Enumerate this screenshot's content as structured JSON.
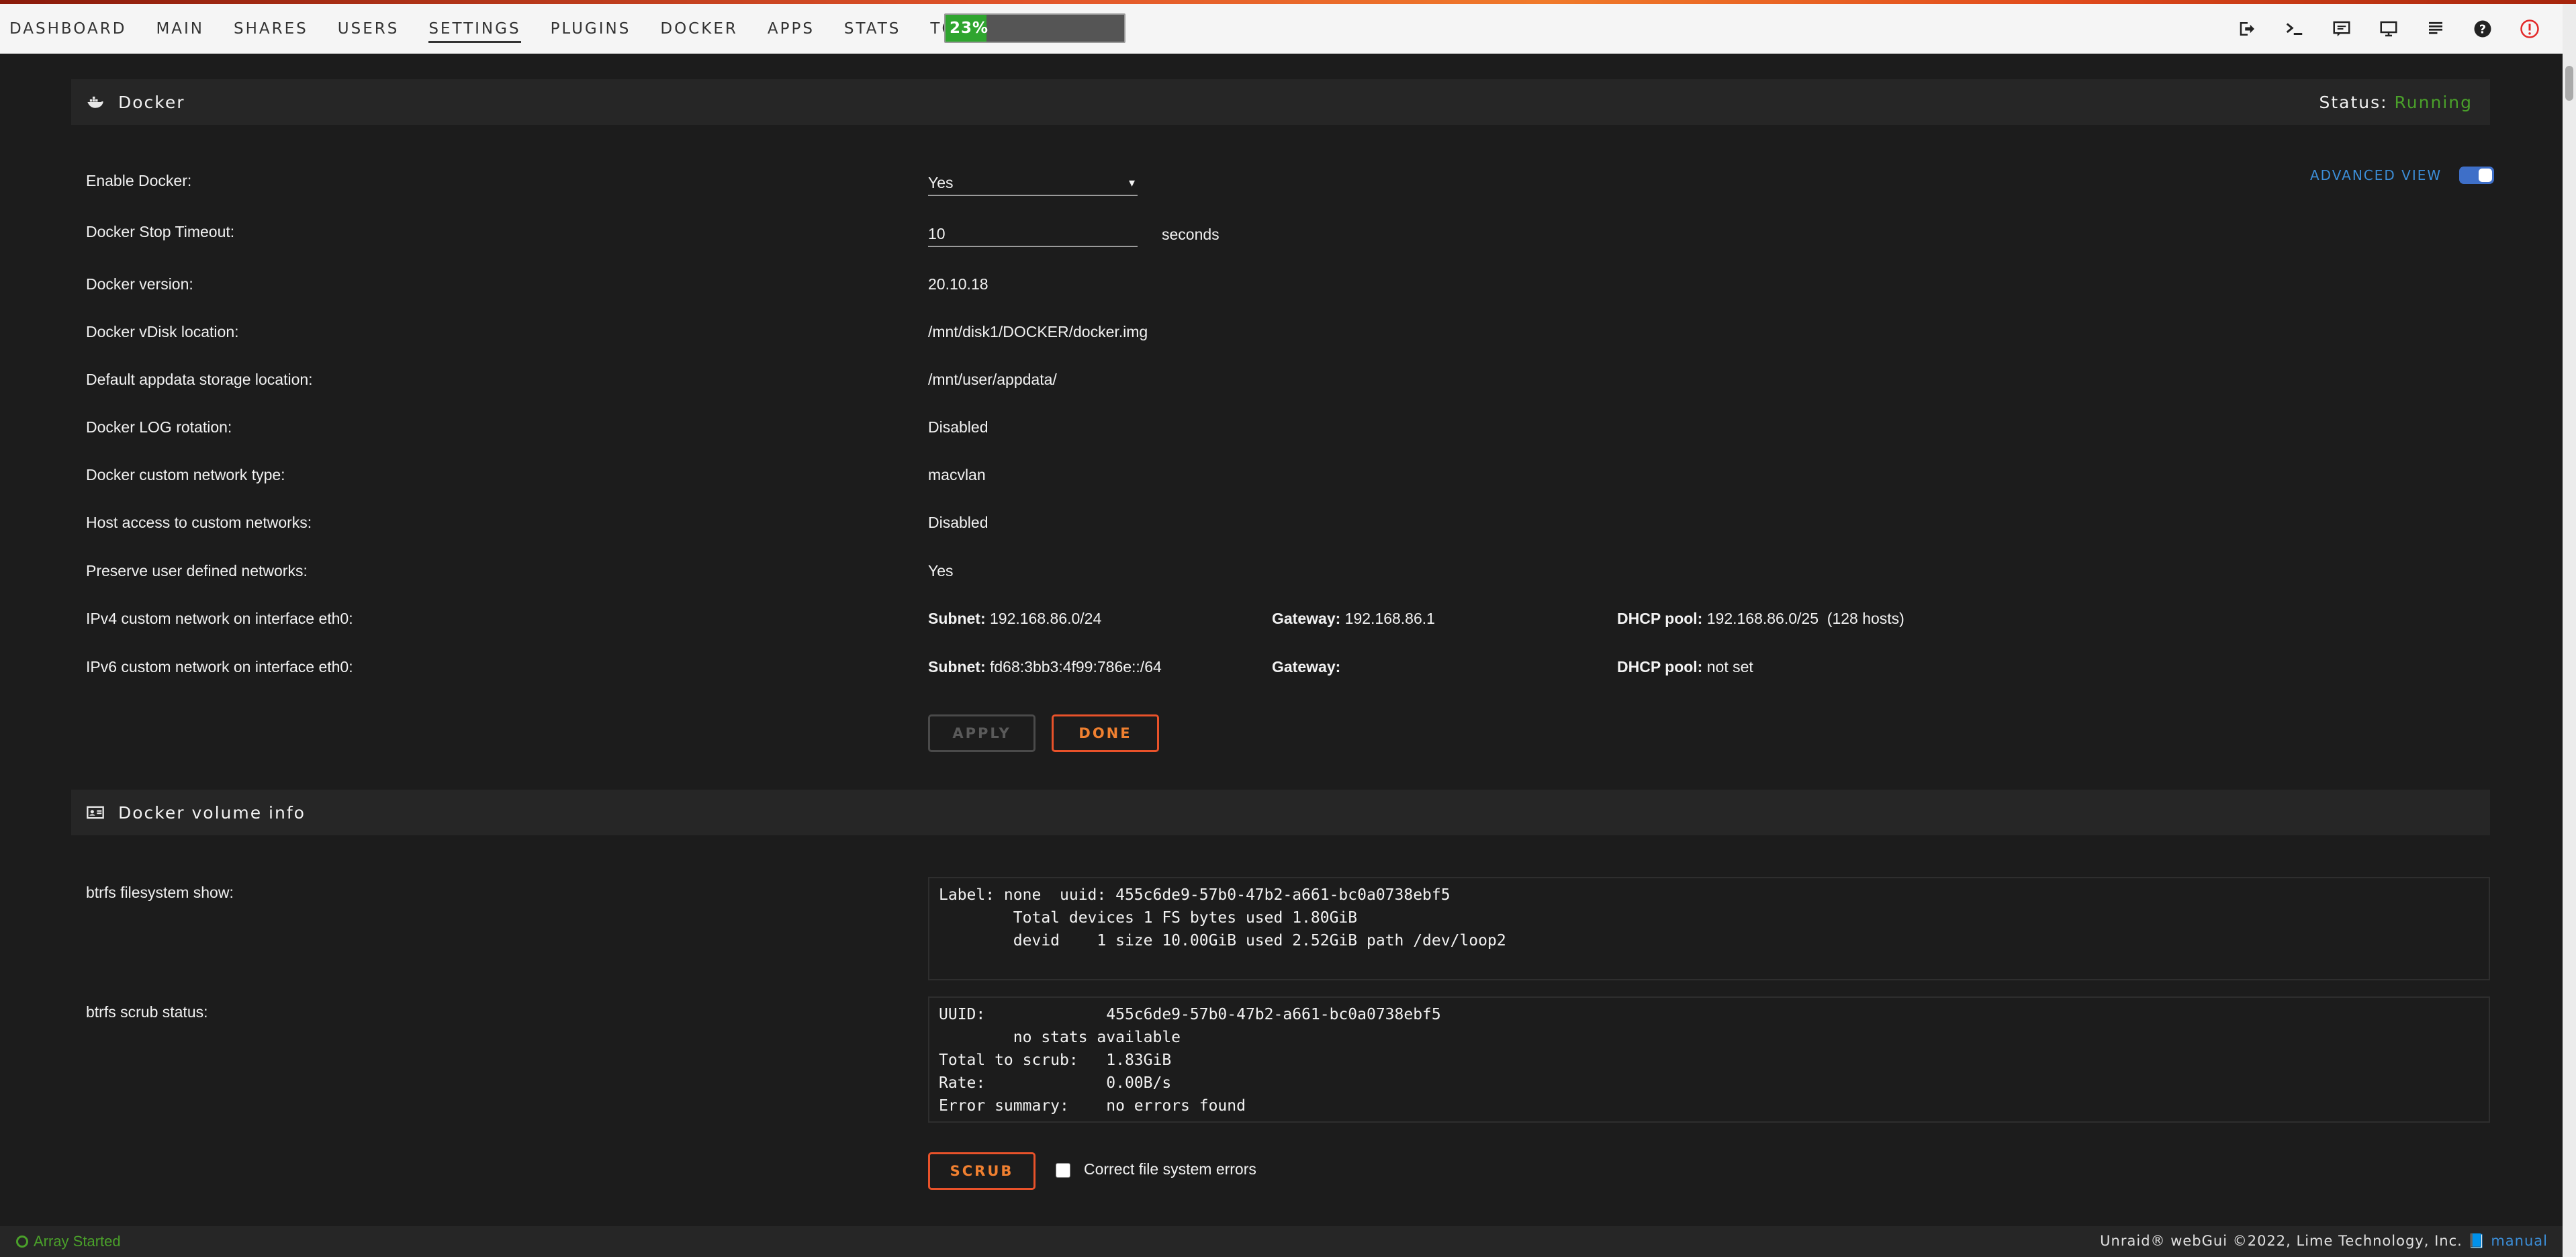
{
  "nav": {
    "items": [
      "DASHBOARD",
      "MAIN",
      "SHARES",
      "USERS",
      "SETTINGS",
      "PLUGINS",
      "DOCKER",
      "APPS",
      "STATS",
      "TOOLS"
    ],
    "active": "SETTINGS",
    "cpu_label": "23%",
    "cpu_fraction": 0.23
  },
  "toolbar_icons": [
    "logout-icon",
    "terminal-icon",
    "feedback-icon",
    "info-icon",
    "log-icon",
    "help-icon",
    "notification-icon"
  ],
  "docker": {
    "title": "Docker",
    "status_label": "Status:",
    "status_value": "Running",
    "advanced_view": "ADVANCED VIEW",
    "rows": {
      "enable_label": "Enable Docker:",
      "enable_value": "Yes",
      "timeout_label": "Docker Stop Timeout:",
      "timeout_value": "10",
      "timeout_unit": "seconds",
      "version_label": "Docker version:",
      "version_value": "20.10.18",
      "vdisk_label": "Docker vDisk location:",
      "vdisk_value": "/mnt/disk1/DOCKER/docker.img",
      "appdata_label": "Default appdata storage location:",
      "appdata_value": "/mnt/user/appdata/",
      "log_label": "Docker LOG rotation:",
      "log_value": "Disabled",
      "nettype_label": "Docker custom network type:",
      "nettype_value": "macvlan",
      "hostaccess_label": "Host access to custom networks:",
      "hostaccess_value": "Disabled",
      "preserve_label": "Preserve user defined networks:",
      "preserve_value": "Yes",
      "ipv4_label": "IPv4 custom network on interface eth0:",
      "ipv4_subnet_k": "Subnet:",
      "ipv4_subnet_v": "192.168.86.0/24",
      "ipv4_gateway_k": "Gateway:",
      "ipv4_gateway_v": "192.168.86.1",
      "ipv4_dhcp_k": "DHCP pool:",
      "ipv4_dhcp_v": "192.168.86.0/25  (128 hosts)",
      "ipv6_label": "IPv6 custom network on interface eth0:",
      "ipv6_subnet_k": "Subnet:",
      "ipv6_subnet_v": "fd68:3bb3:4f99:786e::/64",
      "ipv6_gateway_k": "Gateway:",
      "ipv6_gateway_v": "",
      "ipv6_dhcp_k": "DHCP pool:",
      "ipv6_dhcp_v": "not set"
    },
    "apply_label": "APPLY",
    "done_label": "DONE"
  },
  "volume": {
    "title": "Docker volume info",
    "fs_label": "btrfs filesystem show:",
    "fs_output": "Label: none  uuid: 455c6de9-57b0-47b2-a661-bc0a0738ebf5\n\tTotal devices 1 FS bytes used 1.80GiB\n\tdevid    1 size 10.00GiB used 2.52GiB path /dev/loop2",
    "scrub_label": "btrfs scrub status:",
    "scrub_output": "UUID:             455c6de9-57b0-47b2-a661-bc0a0738ebf5\n\tno stats available\nTotal to scrub:   1.83GiB\nRate:             0.00B/s\nError summary:    no errors found",
    "scrub_button": "SCRUB",
    "correct_label": "Correct file system errors"
  },
  "footer": {
    "array_status": "Array Started",
    "copyright": "Unraid® webGui ©2022, Lime Technology, Inc.",
    "manual": "manual"
  },
  "colors": {
    "accent_orange": "#e8522a",
    "running_green": "#4aa02a",
    "link_blue": "#3c8ed8"
  }
}
